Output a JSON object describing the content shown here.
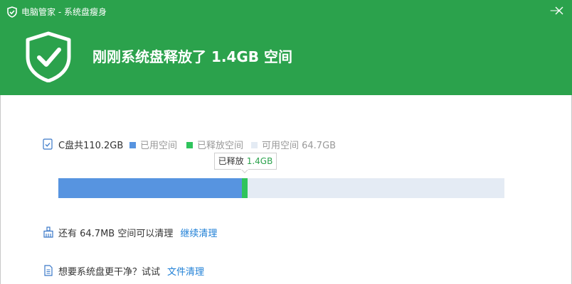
{
  "window": {
    "title": "电脑管家 - 系统盘瘦身",
    "minimize_glyph": "—",
    "close_glyph": "✕"
  },
  "header": {
    "headline": "刚刚系统盘释放了 1.4GB 空间",
    "icon": "shield-check-icon"
  },
  "disk": {
    "label": "C盘共110.2GB",
    "legend": {
      "used": "已用空间",
      "freed": "已释放空间",
      "available": "可用空间 64.7GB"
    },
    "tooltip": {
      "label": "已释放",
      "value": "1.4GB"
    },
    "usage": {
      "total_gb": 110.2,
      "freed_gb": 1.4,
      "available_gb": 64.7,
      "used_fraction": 0.412,
      "freed_fraction": 0.013
    }
  },
  "tips": [
    {
      "text": "还有 64.7MB 空间可以清理",
      "link": "继续清理",
      "icon": "broom-icon"
    },
    {
      "text": "想要系统盘更干净？试试",
      "link": "文件清理",
      "icon": "document-icon"
    }
  ],
  "colors": {
    "header_bg": "#2ba24c",
    "used": "#5794e0",
    "freed": "#2fc45c",
    "available": "#e4ebf4",
    "link": "#1e7fd6"
  }
}
